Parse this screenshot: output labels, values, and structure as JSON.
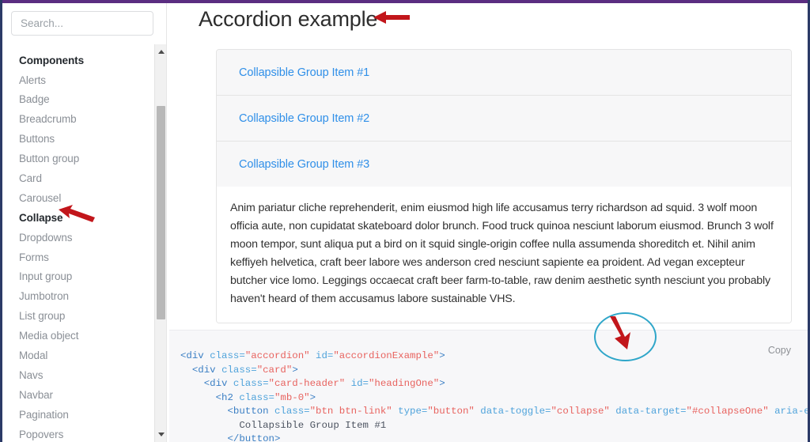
{
  "browser": {
    "top_accent_color": "#5b2d81",
    "frame_border_color": "#2b3a67"
  },
  "sidebar": {
    "search": {
      "placeholder": "Search...",
      "value": ""
    },
    "items": [
      {
        "label": "Components",
        "type": "heading"
      },
      {
        "label": "Alerts",
        "type": "link"
      },
      {
        "label": "Badge",
        "type": "link"
      },
      {
        "label": "Breadcrumb",
        "type": "link"
      },
      {
        "label": "Buttons",
        "type": "link"
      },
      {
        "label": "Button group",
        "type": "link"
      },
      {
        "label": "Card",
        "type": "link"
      },
      {
        "label": "Carousel",
        "type": "link"
      },
      {
        "label": "Collapse",
        "type": "active"
      },
      {
        "label": "Dropdowns",
        "type": "link"
      },
      {
        "label": "Forms",
        "type": "link"
      },
      {
        "label": "Input group",
        "type": "link"
      },
      {
        "label": "Jumbotron",
        "type": "link"
      },
      {
        "label": "List group",
        "type": "link"
      },
      {
        "label": "Media object",
        "type": "link"
      },
      {
        "label": "Modal",
        "type": "link"
      },
      {
        "label": "Navs",
        "type": "link"
      },
      {
        "label": "Navbar",
        "type": "link"
      },
      {
        "label": "Pagination",
        "type": "link"
      },
      {
        "label": "Popovers",
        "type": "link"
      }
    ]
  },
  "main": {
    "title": "Accordion example",
    "accordion": {
      "items": [
        {
          "label": "Collapsible Group Item #1"
        },
        {
          "label": "Collapsible Group Item #2"
        },
        {
          "label": "Collapsible Group Item #3"
        }
      ],
      "body": "Anim pariatur cliche reprehenderit, enim eiusmod high life accusamus terry richardson ad squid. 3 wolf moon officia aute, non cupidatat skateboard dolor brunch. Food truck quinoa nesciunt laborum eiusmod. Brunch 3 wolf moon tempor, sunt aliqua put a bird on it squid single-origin coffee nulla assumenda shoreditch et. Nihil anim keffiyeh helvetica, craft beer labore wes anderson cred nesciunt sapiente ea proident. Ad vegan excepteur butcher vice lomo. Leggings occaecat craft beer farm-to-table, raw denim aesthetic synth nesciunt you probably haven't heard of them accusamus labore sustainable VHS."
    },
    "code": {
      "copy_label": "Copy",
      "lines": [
        [
          {
            "t": "<div ",
            "c": "tag"
          },
          {
            "t": "class=",
            "c": "attr"
          },
          {
            "t": "\"accordion\" ",
            "c": "str"
          },
          {
            "t": "id=",
            "c": "attr"
          },
          {
            "t": "\"accordionExample\"",
            "c": "str"
          },
          {
            "t": ">",
            "c": "tag"
          }
        ],
        [
          {
            "t": "  <div ",
            "c": "tag"
          },
          {
            "t": "class=",
            "c": "attr"
          },
          {
            "t": "\"card\"",
            "c": "str"
          },
          {
            "t": ">",
            "c": "tag"
          }
        ],
        [
          {
            "t": "    <div ",
            "c": "tag"
          },
          {
            "t": "class=",
            "c": "attr"
          },
          {
            "t": "\"card-header\" ",
            "c": "str"
          },
          {
            "t": "id=",
            "c": "attr"
          },
          {
            "t": "\"headingOne\"",
            "c": "str"
          },
          {
            "t": ">",
            "c": "tag"
          }
        ],
        [
          {
            "t": "      <h2 ",
            "c": "tag"
          },
          {
            "t": "class=",
            "c": "attr"
          },
          {
            "t": "\"mb-0\"",
            "c": "str"
          },
          {
            "t": ">",
            "c": "tag"
          }
        ],
        [
          {
            "t": "        <button ",
            "c": "tag"
          },
          {
            "t": "class=",
            "c": "attr"
          },
          {
            "t": "\"btn btn-link\" ",
            "c": "str"
          },
          {
            "t": "type=",
            "c": "attr"
          },
          {
            "t": "\"button\" ",
            "c": "str"
          },
          {
            "t": "data-toggle=",
            "c": "attr"
          },
          {
            "t": "\"collapse\" ",
            "c": "str"
          },
          {
            "t": "data-target=",
            "c": "attr"
          },
          {
            "t": "\"#collapseOne\" ",
            "c": "str"
          },
          {
            "t": "aria-expand",
            "c": "attr"
          }
        ],
        [
          {
            "t": "          Collapsible Group Item #1",
            "c": "txt"
          }
        ],
        [
          {
            "t": "        </button>",
            "c": "tag"
          }
        ]
      ]
    }
  },
  "annotations": {
    "arrow_color": "#c2161b",
    "circle_color": "#2fa6c9",
    "title_arrow": "points-left-at-page-title",
    "collapse_arrow": "points-up-left-at-collapse-item",
    "copy_arrow": "points-down-at-copy-button"
  }
}
